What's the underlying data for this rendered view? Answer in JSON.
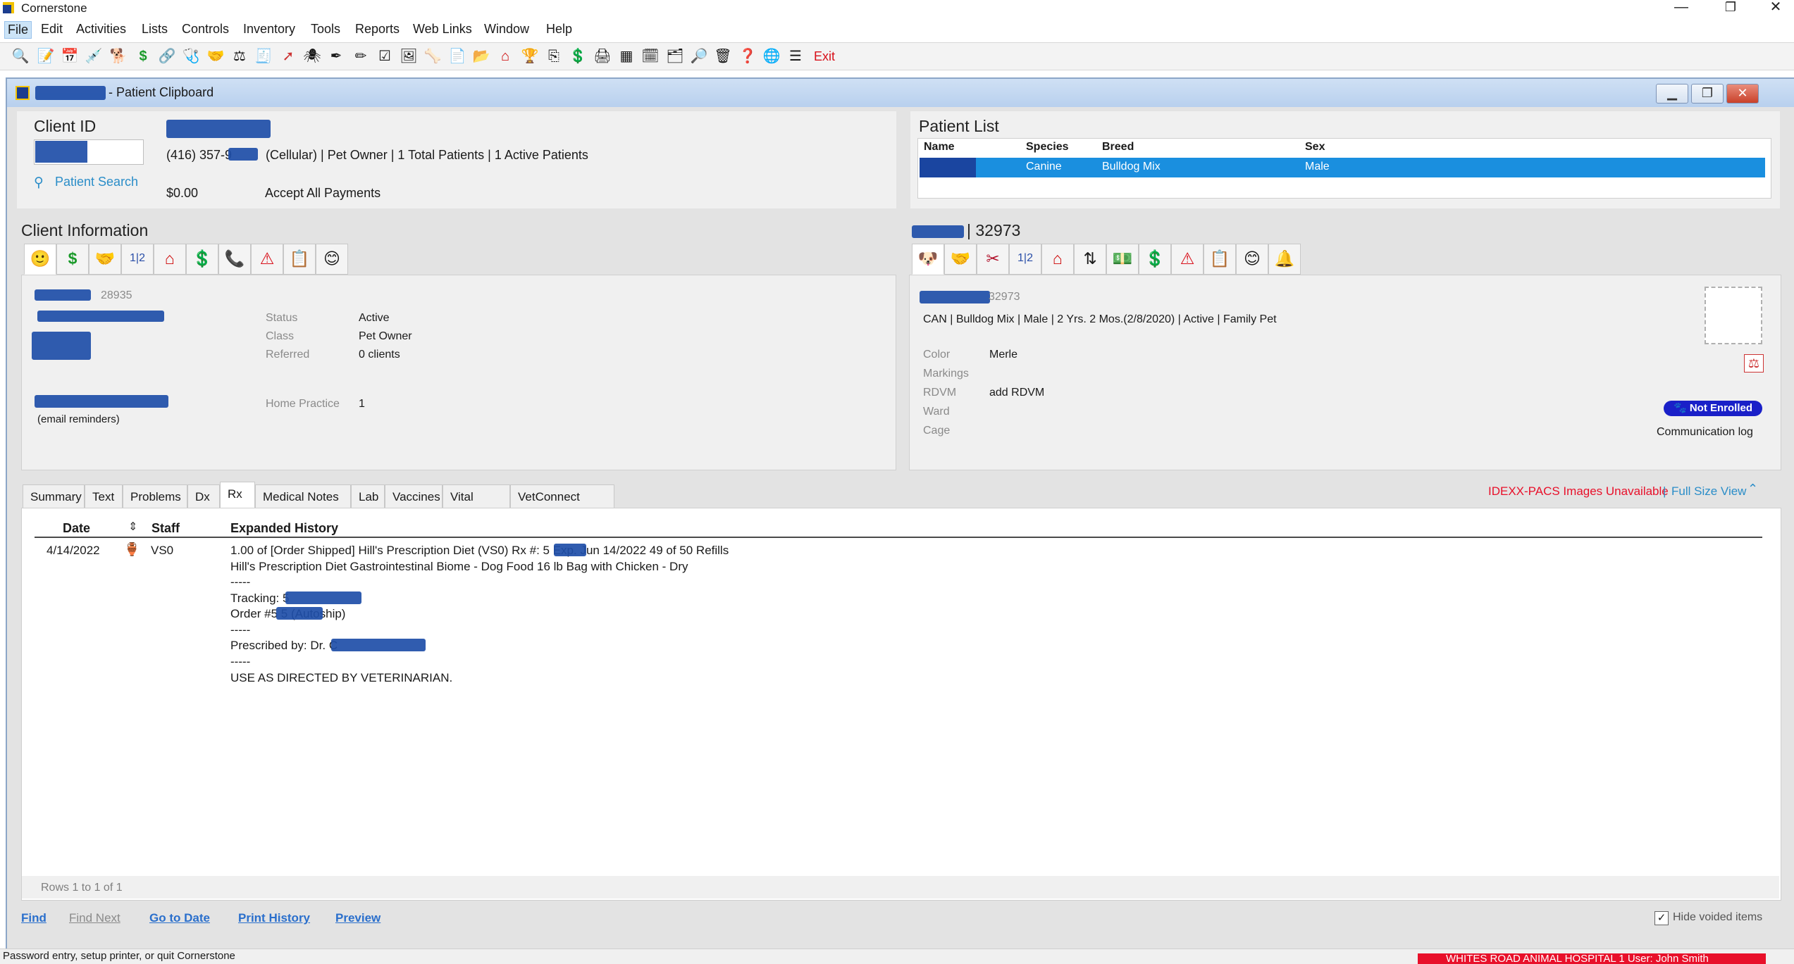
{
  "app": {
    "title": "Cornerstone",
    "window_controls": {
      "minimize": "—",
      "restore": "❐",
      "close": "✕"
    }
  },
  "menu": [
    "File",
    "Edit",
    "Activities",
    "Lists",
    "Controls",
    "Inventory",
    "Tools",
    "Reports",
    "Web Links",
    "Window",
    "Help"
  ],
  "toolbar": {
    "icons": [
      "magnifier-icon",
      "notepad-icon",
      "calendar-icon",
      "syringe-icon",
      "patient-visit-icon",
      "dollar-icon",
      "linked-icon",
      "stethoscope-icon",
      "handshake-icon",
      "scale-icon",
      "invoice-icon",
      "arrow-icon",
      "spider-icon",
      "pen-icon",
      "pencil-icon",
      "checklist-icon",
      "image-icon",
      "xray-icon",
      "document-icon",
      "folder-icon",
      "house-icon",
      "cup-icon",
      "copy-icon",
      "dollar-doc-icon",
      "printer-icon",
      "grid-icon",
      "calendar2-icon",
      "globe-doc-icon",
      "search-icon",
      "trash-icon",
      "help-icon",
      "globe-icon",
      "list-icon"
    ],
    "exit_label": "Exit"
  },
  "clipboard": {
    "window_title": "- Patient Clipboard",
    "client_id_label": "Client ID",
    "phone_line": "(416) 357-9",
    "phone_suffix": "(Cellular) | Pet Owner | 1 Total Patients | 1 Active Patients",
    "patient_search_label": "Patient Search",
    "balance": "$0.00",
    "payment_status": "Accept All Payments",
    "client_info_header": "Client Information",
    "client_number": "28935",
    "client_fields": [
      {
        "label": "Status",
        "value": "Active"
      },
      {
        "label": "Class",
        "value": "Pet Owner"
      },
      {
        "label": "Referred",
        "value": "0 clients"
      }
    ],
    "home_practice_label": "Home Practice",
    "home_practice_value": "1",
    "email_note": "(email reminders)"
  },
  "patient_list": {
    "header": "Patient List",
    "columns": [
      "Name",
      "Species",
      "Breed",
      "Sex"
    ],
    "rows": [
      {
        "species": "Canine",
        "breed": "Bulldog Mix",
        "sex": "Male"
      }
    ]
  },
  "patient": {
    "id_header": "| 32973",
    "id_short": "32973",
    "summary": "CAN | Bulldog Mix | Male | 2 Yrs. 2 Mos.(2/8/2020) | Active | Family Pet",
    "fields": [
      {
        "label": "Color",
        "value": "Merle"
      },
      {
        "label": "Markings",
        "value": ""
      },
      {
        "label": "RDVM",
        "value": "add RDVM"
      },
      {
        "label": "Ward",
        "value": ""
      },
      {
        "label": "Cage",
        "value": ""
      }
    ],
    "badge": "Not Enrolled",
    "communication_log": "Communication log"
  },
  "tabs": [
    "Summary",
    "Text",
    "Problems",
    "Dx",
    "Rx",
    "Medical Notes",
    "Lab",
    "Vaccines",
    "Vital Signs",
    "VetConnect PLUS"
  ],
  "active_tab": "Rx",
  "pacs": {
    "unavailable": "IDEXX-PACS Images Unavailable",
    "separator": "|",
    "full_size": "Full Size View"
  },
  "history_table": {
    "columns": [
      "Date",
      "Staff",
      "Expanded History"
    ],
    "rows": [
      {
        "date": "4/14/2022",
        "staff": "VS0",
        "lines": [
          "1.00  of [Order Shipped] Hill's Prescription Diet (VS0) Rx #: 5          Exp. Jun 14/2022 49 of 50 Refills",
          "Hill's Prescription Diet Gastrointestinal Biome - Dog Food 16 lb Bag with Chicken - Dry",
          "-----",
          "Tracking: 5",
          "Order #5           5 (Autoship)",
          "-----",
          "Prescribed by: Dr. C",
          " -----",
          "USE AS DIRECTED BY VETERINARIAN."
        ]
      }
    ],
    "row_count": "Rows 1 to 1 of 1"
  },
  "footer": {
    "find": "Find",
    "find_next": "Find Next",
    "go_to_date": "Go to Date",
    "print_history": "Print History",
    "preview": "Preview",
    "hide_voided": "Hide voided items"
  },
  "statusbar": {
    "message": "Password entry, setup printer, or quit Cornerstone",
    "hospital": "WHITES ROAD ANIMAL HOSPITAL   1     User: John Smith"
  },
  "colors": {
    "accent": "#1a8fdf",
    "link": "#2a8dc8",
    "danger": "#e8102a",
    "badge": "#1a20c8",
    "redaction": "#1e4ea8"
  }
}
